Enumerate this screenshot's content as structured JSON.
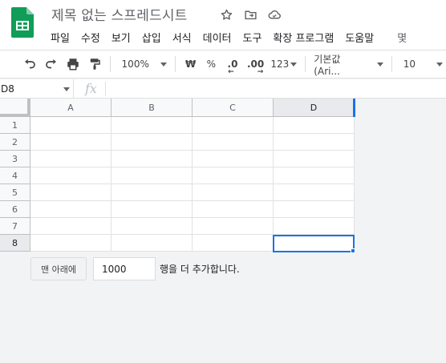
{
  "document": {
    "title": "제목 없는 스프레드시트"
  },
  "menu": {
    "items": [
      "파일",
      "수정",
      "보기",
      "삽입",
      "서식",
      "데이터",
      "도구",
      "확장 프로그램",
      "도움말",
      "몇"
    ]
  },
  "toolbar": {
    "zoom": "100%",
    "currency": "₩",
    "percent": "%",
    "decimal_decrease": ".0",
    "decimal_increase": ".00",
    "more_formats": "123",
    "font": "기본값 (Ari...",
    "font_size": "10"
  },
  "formula_bar": {
    "name_box": "D8",
    "fx": "fx",
    "value": ""
  },
  "grid": {
    "columns": [
      "A",
      "B",
      "C",
      "D"
    ],
    "rows": [
      "1",
      "2",
      "3",
      "4",
      "5",
      "6",
      "7",
      "8"
    ],
    "active_cell": "D8",
    "active_column": "D",
    "active_row": "8"
  },
  "add_rows": {
    "button_label": "맨 아래에",
    "count_value": "1000",
    "suffix": "행을 더 추가합니다."
  },
  "colors": {
    "accent": "#1a73e8",
    "sheets_green": "#0f9d58"
  }
}
